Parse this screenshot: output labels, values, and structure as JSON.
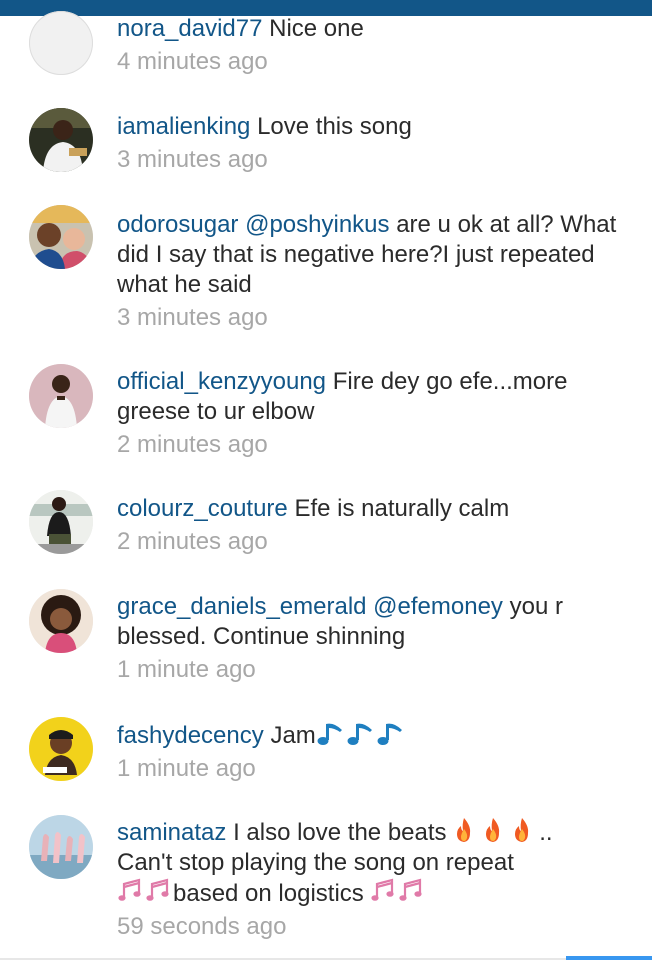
{
  "comments": [
    {
      "username": "nora_david77",
      "text": "Nice one",
      "time": "4 minutes ago",
      "avatar": "blank-avatar"
    },
    {
      "username": "iamalienking",
      "text": "Love this song",
      "time": "3 minutes ago",
      "avatar": "user-photo"
    },
    {
      "username": "odorosugar",
      "mention": "@poshyinkus",
      "text": "are u ok at all? What did I say that is negative here?I just repeated what he said",
      "time": "3 minutes ago",
      "avatar": "user-photo"
    },
    {
      "username": "official_kenzyyoung",
      "text": "Fire dey go efe...more greese to ur elbow",
      "time": "2 minutes ago",
      "avatar": "user-photo"
    },
    {
      "username": "colourz_couture",
      "text": "Efe  is naturally calm",
      "time": "2 minutes ago",
      "avatar": "user-photo"
    },
    {
      "username": "grace_daniels_emerald",
      "mention": "@efemoney",
      "text": "you r blessed. Continue shinning",
      "time": "1 minute ago",
      "avatar": "user-photo"
    },
    {
      "username": "fashydecency",
      "text": "Jam",
      "emojis": [
        "music-note-icon",
        "music-note-icon",
        "music-note-icon"
      ],
      "time": "1 minute ago",
      "avatar": "user-photo"
    },
    {
      "username": "saminataz",
      "text_1": "I also love the beats",
      "emojis_1": [
        "fire-icon",
        "fire-icon",
        "fire-icon"
      ],
      "text_2": "..",
      "text_3": "Can't stop playing the song on repeat",
      "text_4": "based on logistics",
      "emojis_2": [
        "notes-icon",
        "notes-icon"
      ],
      "emojis_3": [
        "notes-icon",
        "notes-icon"
      ],
      "time": "59 seconds ago",
      "avatar": "user-photo"
    }
  ],
  "colors": {
    "header_bar": "#125688",
    "username": "#125688",
    "comment_text": "#2b2b2b",
    "timestamp": "#a7a7a7",
    "active_indicator": "#3897f0"
  }
}
